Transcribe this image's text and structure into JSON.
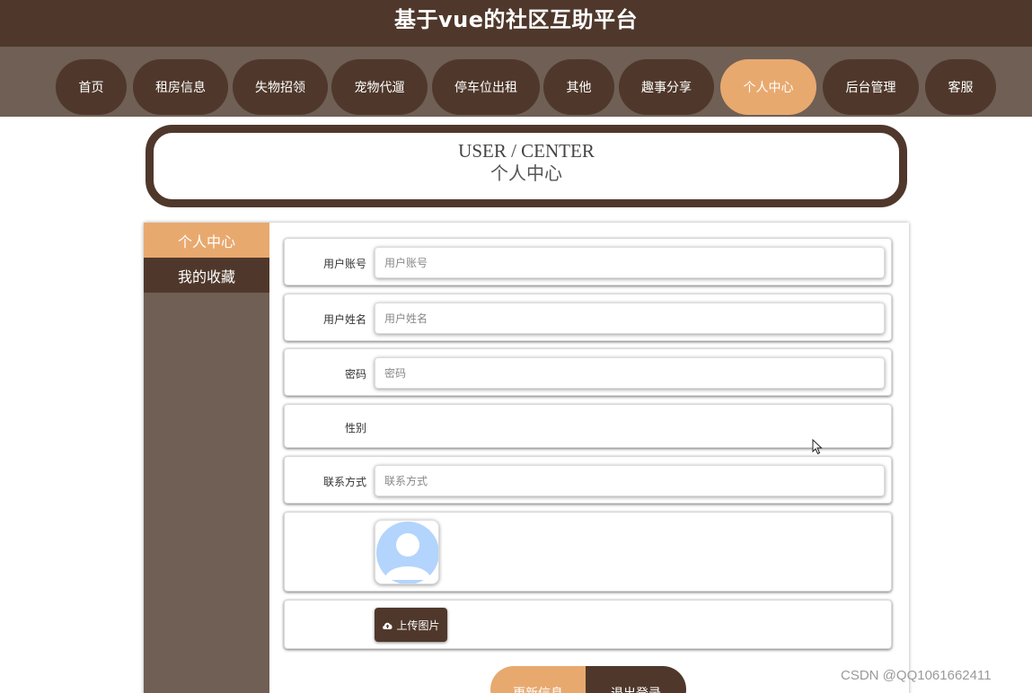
{
  "site": {
    "title": "基于vue的社区互助平台"
  },
  "nav": {
    "items": [
      {
        "label": "首页"
      },
      {
        "label": "租房信息"
      },
      {
        "label": "失物招领"
      },
      {
        "label": "宠物代遛"
      },
      {
        "label": "停车位出租"
      },
      {
        "label": "其他"
      },
      {
        "label": "趣事分享"
      },
      {
        "label": "个人中心"
      },
      {
        "label": "后台管理"
      },
      {
        "label": "客服"
      }
    ],
    "active": "个人中心"
  },
  "header": {
    "title_en": "USER / CENTER",
    "title_cn": "个人中心"
  },
  "sidebar": {
    "items": [
      {
        "label": "个人中心",
        "active": true
      },
      {
        "label": "我的收藏",
        "active": false
      }
    ]
  },
  "form": {
    "account": {
      "label": "用户账号",
      "placeholder": "用户账号"
    },
    "name": {
      "label": "用户姓名",
      "placeholder": "用户姓名"
    },
    "password": {
      "label": "密码",
      "placeholder": "密码"
    },
    "gender": {
      "label": "性别"
    },
    "contact": {
      "label": "联系方式",
      "placeholder": "联系方式"
    },
    "upload_label": "上传图片"
  },
  "actions": {
    "update": "更新信息",
    "logout": "退出登录"
  },
  "watermark": "CSDN @QQ1061662411",
  "colors": {
    "primary_dark": "#4f382b",
    "nav_bg": "#6f5f55",
    "accent": "#e8a96f",
    "avatar_blue": "#b3d4fc"
  },
  "icons": {
    "avatar": "user-avatar-icon",
    "upload": "cloud-upload-icon",
    "cursor": "mouse-pointer-icon"
  }
}
